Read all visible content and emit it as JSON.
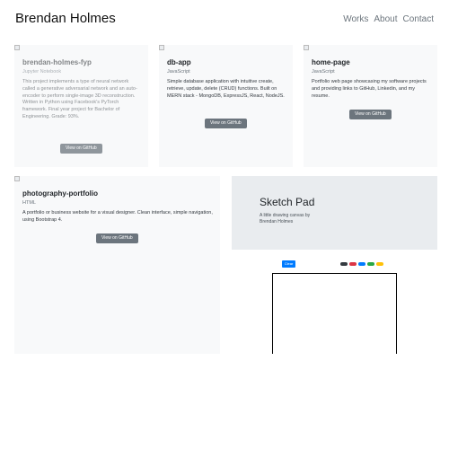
{
  "header": {
    "brand": "Brendan Holmes",
    "nav": [
      "Works",
      "About",
      "Contact"
    ]
  },
  "projects": [
    {
      "title": "brendan-holmes-fyp",
      "language": "Jupyter Notebook",
      "description": "This project implements a type of neural network called a generative adversarial network and an auto-encoder to perform single-image 3D reconstruction. Written in Python using Facebook's PyTorch framework. Final year project for Bachelor of Engineering. Grade: 93%.",
      "button": "View on GitHub"
    },
    {
      "title": "db-app",
      "language": "JavaScript",
      "description": "Simple database application with intuitive create, retrieve, update, delete (CRUD) functions. Built on MERN stack - MongoDB, ExpressJS, React, NodeJS.",
      "button": "View on GitHub"
    },
    {
      "title": "home-page",
      "language": "JavaScript",
      "description": "Portfolio web page showcasing my software projects and providing links to GitHub, Linkedin, and my resume.",
      "button": "View on GitHub"
    },
    {
      "title": "photography-portfolio",
      "language": "HTML",
      "description": "A portfolio or business website for a visual designer. Clean interface, simple navigation, using Bootstrap 4.",
      "button": "View on GitHub"
    }
  ],
  "sketchpad": {
    "title": "Sketch Pad",
    "subtitle": "A little drawing canvas by Brendan Holmes",
    "clear_label": "Clear",
    "swatches": [
      {
        "name": "black",
        "color": "#343a40"
      },
      {
        "name": "red",
        "color": "#dc3545"
      },
      {
        "name": "blue",
        "color": "#007bff"
      },
      {
        "name": "green",
        "color": "#28a745"
      },
      {
        "name": "yellow",
        "color": "#ffc107"
      }
    ]
  }
}
